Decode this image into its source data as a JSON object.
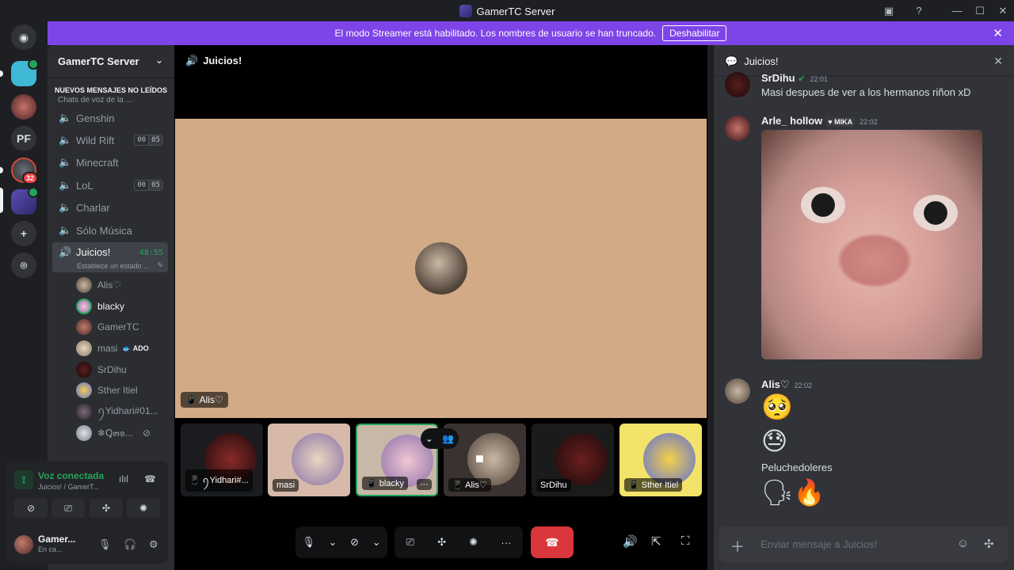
{
  "window": {
    "title": "GamerTC Server"
  },
  "banner": {
    "text": "El modo Streamer está habilitado. Los nombres de usuario se han truncado.",
    "button": "Deshabilitar"
  },
  "server": {
    "name": "GamerTC Server",
    "unread_label": "NUEVOS MENSAJES NO LEÍDOS",
    "category": "Chats de voz de la ..."
  },
  "rail": {
    "pf_label": "PF",
    "badge_count": "32"
  },
  "channels": [
    {
      "name": "Genshin"
    },
    {
      "name": "Wild Rift",
      "count_a": "00",
      "count_b": "05"
    },
    {
      "name": "Minecraft"
    },
    {
      "name": "LoL",
      "count_a": "00",
      "count_b": "05"
    },
    {
      "name": "Charlar"
    },
    {
      "name": "Sólo Música"
    }
  ],
  "active_channel": {
    "name": "Juicios!",
    "timer": "48:55",
    "status": "Establece un estado ..."
  },
  "members": [
    {
      "name": "Alis♡"
    },
    {
      "name": "blacky"
    },
    {
      "name": "GamerTC"
    },
    {
      "name": "masi",
      "tag": "ADO"
    },
    {
      "name": "SrDihu"
    },
    {
      "name": "Sther Itiel"
    },
    {
      "name": "ꪆYidhari#01..."
    },
    {
      "name": "❄Ꝗ๓๏..."
    }
  ],
  "voice": {
    "status": "Voz conectada",
    "location": "Juicios! / GamerT..."
  },
  "user": {
    "name": "Gamer...",
    "status": "En ca..."
  },
  "call": {
    "channel": "Juicios!",
    "focused": "Alis♡",
    "tiles": [
      "ꪆYidhari#...",
      "masi",
      "blacky",
      "Alis♡",
      "SrDihu",
      "Sther Itiel"
    ]
  },
  "chat": {
    "channel": "Juicios!",
    "messages": [
      {
        "author": "SrDihu",
        "time": "22:01",
        "text": "Masi despues de ver a los hermanos riñon xD"
      },
      {
        "author": "Arle_ hollow",
        "role": "MIKA",
        "time": "22:02"
      },
      {
        "author": "Alis♡",
        "time": "22:02",
        "text": "Peluchedoleres"
      }
    ],
    "input_placeholder": "Enviar mensaje a Juicios!"
  }
}
